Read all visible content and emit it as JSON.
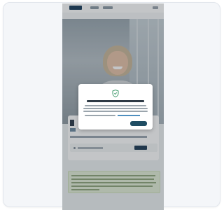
{
  "colors": {
    "card_bg": "#f4f6f9",
    "brand_navy": "#1a3c5a",
    "accent_red": "#d46b58",
    "modal_button": "#1f4d63",
    "shield": "#3f9a6b",
    "notice_bg": "#e4efd8"
  },
  "icons": {
    "shield": "shield-check-icon",
    "search": "search-icon"
  }
}
